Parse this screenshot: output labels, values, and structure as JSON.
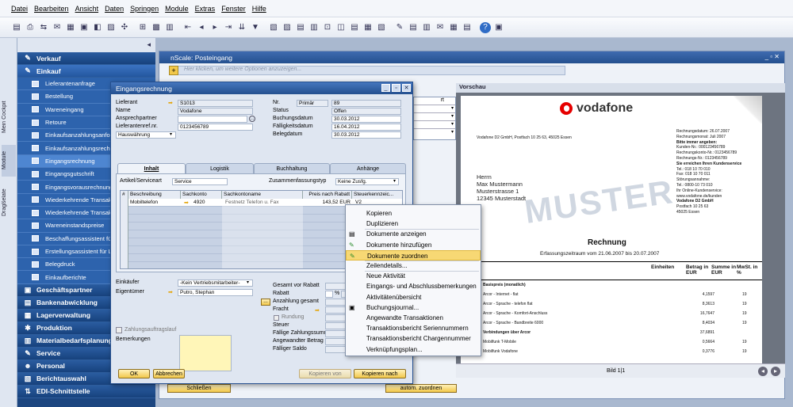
{
  "menu": [
    "Datei",
    "Bearbeiten",
    "Ansicht",
    "Daten",
    "Springen",
    "Module",
    "Extras",
    "Fenster",
    "Hilfe"
  ],
  "left_tabs": [
    "Mein Cockpit",
    "Module",
    "Dragßelate"
  ],
  "sidebar": {
    "sections_top": [
      {
        "label": "Verkauf",
        "icon": "handshake-icon",
        "glyph": "✎"
      },
      {
        "label": "Einkauf",
        "icon": "cart-icon",
        "glyph": "✎"
      }
    ],
    "items": [
      "Lieferantenanfrage",
      "Bestellung",
      "Wareneingang",
      "Retoure",
      "Einkaufsanzahlungsanfor",
      "Einkaufsanzahlungsrechn",
      "Eingangsrechnung",
      "Eingangsgutschrift",
      "Eingangsvorausrechnung",
      "Wiederkehrende Transak",
      "Wiederkehrende Transak",
      "Wareneinstandspreise",
      "Beschaffungsassistent fü",
      "Erstellungsassistent für L",
      "Belegdruck",
      "Einkaufberichte"
    ],
    "sections_bottom": [
      {
        "label": "Geschäftspartner",
        "glyph": "▣"
      },
      {
        "label": "Bankenabwicklung",
        "glyph": "▤"
      },
      {
        "label": "Lagerverwaltung",
        "glyph": "▦"
      },
      {
        "label": "Produktion",
        "glyph": "✱"
      },
      {
        "label": "Materialbedarfsplanung",
        "glyph": "▥"
      },
      {
        "label": "Service",
        "glyph": "✎"
      },
      {
        "label": "Personal",
        "glyph": "☻"
      },
      {
        "label": "Berichtauswahl",
        "glyph": "▧"
      },
      {
        "label": "EDI-Schnittstelle",
        "glyph": "⇅"
      }
    ]
  },
  "posteingang": {
    "title": "nScale: Posteingang",
    "filter_placeholder": "Hier klicken, um weitere Optionen anzuzeigen..."
  },
  "preview": {
    "title": "Vorschau",
    "brand": "vodafone",
    "watermark": "MUSTER",
    "sender_line": "Vodafone D2 GmbH, Postfach 10 25 63, 45025 Essen",
    "address": [
      "Herrn",
      "Max Mustermann",
      "Musterstrasse 1",
      "12345 Musterstadt"
    ],
    "info": [
      "Rechnungsdatum: 26.07.2007",
      "Rechnungsmonat: Juli 2007",
      "Bitte immer angeben:",
      "Kunden-Nr.: 000123456789",
      "Rechnungskonto-Nr.: 0123456789",
      "Rechnungs-Nr.: 0123456789",
      "Sie erreichen Ihren Kundenservice",
      "Tel.: 018 10 70 010",
      "Fax: 018 10 70 011",
      "Störungsannahme:",
      "Tel.: 0800-10 73 010",
      "Ihr Online-Kundenservice:",
      "www.vodafone.de/kunden",
      "Vodafone D2 GmbH",
      "Postfach 10 25 63",
      "45025 Essen"
    ],
    "heading": "Rechnung",
    "period": "Erfassungszeitraum vom 21.06.2007 bis 20.07.2007",
    "cols": [
      "zahl",
      "Einheiten",
      "Betrag in EUR",
      "Summe in EUR",
      "MwSt. in %"
    ],
    "lines": [
      {
        "t": "Basispreis (monatlich)",
        "v": "",
        "m": ""
      },
      {
        "t": "Arcor - Internet - flat",
        "v": "4,1597",
        "m": "19"
      },
      {
        "t": "Arcor - Sprache - telefon flat",
        "v": "8,3613",
        "m": "19"
      },
      {
        "t": "Arcor - Sprache - Komfort-Anschluss",
        "v": "16,7647",
        "m": "19"
      },
      {
        "t": "Arcor - Sprache - Bandbreite 6000",
        "v": "8,4034",
        "m": "19"
      },
      {
        "t": "Verbindungen über Arcor",
        "v": "37,6891",
        "m": ""
      },
      {
        "t": "Mobilfunk T-Mobile",
        "v": "0,5664",
        "m": "19"
      },
      {
        "t": "Mobilfunk Vodafone",
        "v": "0,3776",
        "m": "19"
      }
    ],
    "status": "Bild  1|1"
  },
  "dialog": {
    "title": "Eingangsrechnung",
    "fields_left": [
      {
        "label": "Lieferant",
        "value": "S1013"
      },
      {
        "label": "Name",
        "value": "Vodafone"
      },
      {
        "label": "Ansprechpartner",
        "value": ""
      },
      {
        "label": "Lieferantenref.nr.",
        "value": "0123456789"
      },
      {
        "label": "",
        "value": "Hauswährung"
      }
    ],
    "fields_right": [
      {
        "label": "Nr.",
        "value": "89",
        "series": "Primär"
      },
      {
        "label": "Status",
        "value": "Offen"
      },
      {
        "label": "Buchungsdatum",
        "value": "30.03.2012"
      },
      {
        "label": "Fälligkeitsdatum",
        "value": "16.04.2012"
      },
      {
        "label": "Belegdatum",
        "value": "30.03.2012"
      }
    ],
    "tabs": [
      "Inhalt",
      "Logistik",
      "Buchhaltung",
      "Anhänge"
    ],
    "item_type_label": "Artikel/Serviceart",
    "item_type_value": "Service",
    "summary_type_label": "Zusammenfassungstyp",
    "summary_type_value": "Keine Zusfg.",
    "grid_headers": [
      "#",
      "Beschreibung",
      "Sachkonto",
      "Sachkontoname",
      "Preis nach Rabatt",
      "Steuerkennzeic..."
    ],
    "grid_rows": [
      {
        "n": "1",
        "desc": "Mobiltelefon",
        "konto": "4920",
        "name": "Festnetz Telefon u. Fax",
        "price": "143,52 EUR",
        "tax": "V2"
      }
    ],
    "buyer_label": "Einkäufer",
    "buyer_value": "-Kein Vertriebsmitarbeiter-",
    "owner_label": "Eigentümer",
    "owner_value": "Putro, Stephan",
    "zahlung_label": "Zahlungsauftragslauf",
    "remarks_label": "Bemerkungen",
    "totals": [
      "Gesamt vor Rabatt",
      "Rabatt",
      "Anzahlung gesamt",
      "Fracht",
      "Rundung",
      "Steuer",
      "Fällige Zahlungssumme",
      "Angewandter Betrag",
      "Fälliger Saldo"
    ],
    "pct": "%",
    "btn_ok": "OK",
    "btn_cancel": "Abbrechen",
    "btn_copy_from": "Kopieren von",
    "btn_copy_to": "Kopieren nach"
  },
  "context_menu": [
    "Kopieren",
    "Duplizieren",
    "Dokumente anzeigen",
    "Dokumente hinzufügen",
    "Dokumente zuordnen",
    "Zeilendetails...",
    "Neue Aktivität",
    "Eingangs- und Abschlussbemerkungen",
    "Aktivitätenübersicht",
    "Buchungsjournal...",
    "Angewandte Transaktionen",
    "Transaktionsbericht Seriennummern",
    "Transaktionsbericht Chargennummer",
    "Verknüpfungsplan..."
  ],
  "bottom_buttons": [
    "Schließen",
    "autom. zuordnen"
  ],
  "colors": {
    "sidebar": "#1c4680",
    "accent": "#f2c84a",
    "title": "#24508f",
    "brand": "#e60000"
  }
}
